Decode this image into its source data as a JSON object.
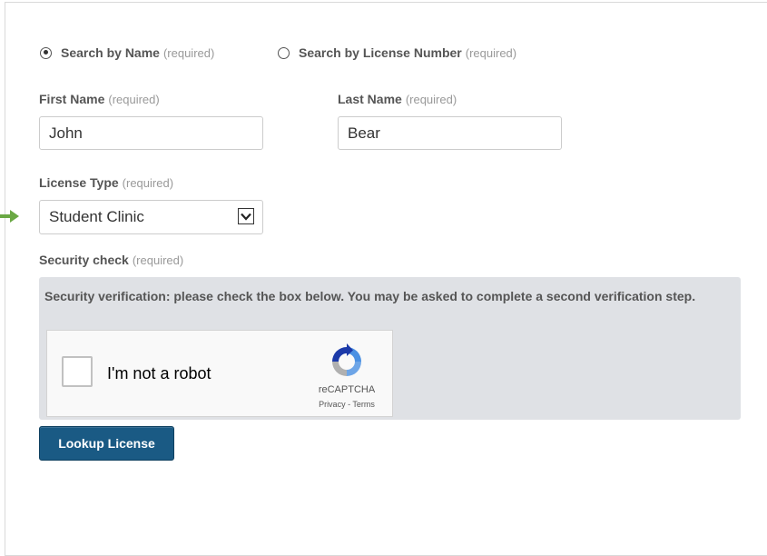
{
  "search_mode": {
    "by_name_label": "Search by Name",
    "by_name_required": "(required)",
    "by_license_label": "Search by License Number",
    "by_license_required": "(required)",
    "selected": "name"
  },
  "first_name": {
    "label": "First Name",
    "required": "(required)",
    "value": "John"
  },
  "last_name": {
    "label": "Last Name",
    "required": "(required)",
    "value": "Bear"
  },
  "license_type": {
    "label": "License Type",
    "required": "(required)",
    "selected": "Student Clinic"
  },
  "security": {
    "label": "Security check",
    "required": "(required)",
    "instruction": "Security verification: please check the box below. You may be asked to complete a second verification step.",
    "captcha_label": "I'm not a robot",
    "captcha_brand": "reCAPTCHA",
    "captcha_privacy": "Privacy",
    "captcha_separator": " - ",
    "captcha_terms": "Terms"
  },
  "submit_label": "Lookup License",
  "colors": {
    "button": "#1a5a84",
    "security_bg": "#dfe1e5",
    "arrow": "#6aa844"
  },
  "icons": [
    "arrow-right-icon",
    "radio-icon",
    "chevron-down-icon",
    "recaptcha-logo-icon"
  ]
}
